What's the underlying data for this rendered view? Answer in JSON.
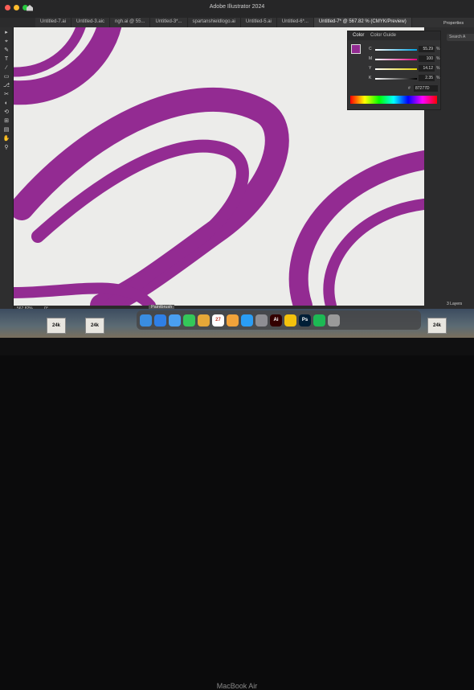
{
  "window": {
    "app_title": "Adobe Illustrator 2024"
  },
  "tabs": [
    "Untitled-7.ai",
    "Untitled-3.aic",
    "ngh.ai @ 55...",
    "Untitled-3*...",
    "spartanshieldlogo.ai",
    "Untitled-5.ai",
    "Untitled-6*...",
    "Untitled-7* @ 567.82 % (CMYK/Preview)"
  ],
  "active_tab_index": 7,
  "tools": [
    "▸",
    "⌖",
    "✎",
    "T",
    "∕",
    "▭",
    "⎇",
    "✂",
    "◐",
    "⟲",
    "⊞",
    "▤",
    "✋",
    "⚲"
  ],
  "color_panel": {
    "tabs": [
      "Color",
      "Color Guide"
    ],
    "channels": [
      {
        "letter": "C",
        "value": "55.29",
        "color": "#00a0e0"
      },
      {
        "letter": "M",
        "value": "100",
        "color": "#e0007a"
      },
      {
        "letter": "Y",
        "value": "14.12",
        "color": "#e6d400"
      },
      {
        "letter": "K",
        "value": "2.35",
        "color": "#000000"
      }
    ],
    "hex_label": "#",
    "hex": "87277D",
    "pct": "%"
  },
  "artwork": {
    "fill": "#932b92",
    "background": "#ececea"
  },
  "status": {
    "zoom": "567.82%",
    "rotation": "0°",
    "tool_tip": "Paintbrush"
  },
  "right_panel": {
    "tab": "Properties",
    "search": "Search A",
    "layers": "3 Layers"
  },
  "dock": {
    "icons": [
      {
        "name": "finder-icon",
        "color": "#3a8de0",
        "label": ""
      },
      {
        "name": "safari-icon",
        "color": "#2f7fe6",
        "label": ""
      },
      {
        "name": "mail-icon",
        "color": "#4a9ff0",
        "label": ""
      },
      {
        "name": "messages-icon",
        "color": "#34c759",
        "label": ""
      },
      {
        "name": "notes-icon",
        "color": "#e6a838",
        "label": ""
      },
      {
        "name": "calendar-icon",
        "color": "#ffffff",
        "label": "27"
      },
      {
        "name": "photos-icon",
        "color": "#f2a33a",
        "label": ""
      },
      {
        "name": "app-store-icon",
        "color": "#2a9df4",
        "label": ""
      },
      {
        "name": "system-settings-icon",
        "color": "#8e8e93",
        "label": ""
      },
      {
        "name": "illustrator-icon",
        "color": "#330000",
        "label": "Ai"
      },
      {
        "name": "chrome-icon",
        "color": "#f4c20d",
        "label": ""
      },
      {
        "name": "photoshop-icon",
        "color": "#001e36",
        "label": "Ps"
      },
      {
        "name": "spotify-icon",
        "color": "#1db954",
        "label": ""
      },
      {
        "name": "trash-icon",
        "color": "#9a9a9a",
        "label": ""
      }
    ]
  },
  "desktop_icons": [
    "24k",
    "24k",
    "24k"
  ],
  "bezel": {
    "brand": "MacBook Air"
  }
}
